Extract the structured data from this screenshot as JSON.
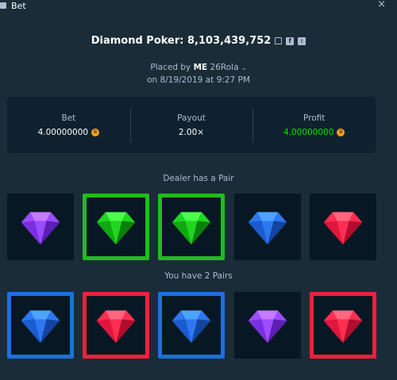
{
  "window": {
    "title": "Bet",
    "close_label": "×"
  },
  "header": {
    "title": "Diamond Poker: 8,103,439,752",
    "placed_prefix": "Placed by",
    "user": "ME",
    "user_suffix": "26Rola",
    "date": "on 8/19/2019 at 9:27 PM"
  },
  "stats": {
    "bet_label": "Bet",
    "bet_value": "4.00000000",
    "payout_label": "Payout",
    "payout_value": "2.00×",
    "profit_label": "Profit",
    "profit_value": "4.00000000"
  },
  "dealer": {
    "label": "Dealer has a Pair",
    "gems": [
      {
        "gem": "purple",
        "highlight": "none"
      },
      {
        "gem": "green",
        "highlight": "green"
      },
      {
        "gem": "green",
        "highlight": "green"
      },
      {
        "gem": "blue",
        "highlight": "none"
      },
      {
        "gem": "red",
        "highlight": "none"
      }
    ]
  },
  "player": {
    "label": "You have 2 Pairs",
    "gems": [
      {
        "gem": "blue",
        "highlight": "blue"
      },
      {
        "gem": "red",
        "highlight": "red"
      },
      {
        "gem": "blue",
        "highlight": "blue"
      },
      {
        "gem": "purple",
        "highlight": "none"
      },
      {
        "gem": "red",
        "highlight": "red"
      }
    ]
  },
  "colors": {
    "background": "#1a2c38",
    "panel": "#0f212e",
    "profit_green": "#00e701",
    "highlight_green": "#1fbd1f",
    "highlight_blue": "#1f6fe0",
    "highlight_red": "#f0203c",
    "coin": "#f6a21c"
  },
  "icons": {
    "copy": "copy-icon",
    "facebook": "facebook-icon",
    "twitter": "twitter-icon",
    "coin": "coin-icon",
    "chevron": "chevron-down-icon"
  }
}
